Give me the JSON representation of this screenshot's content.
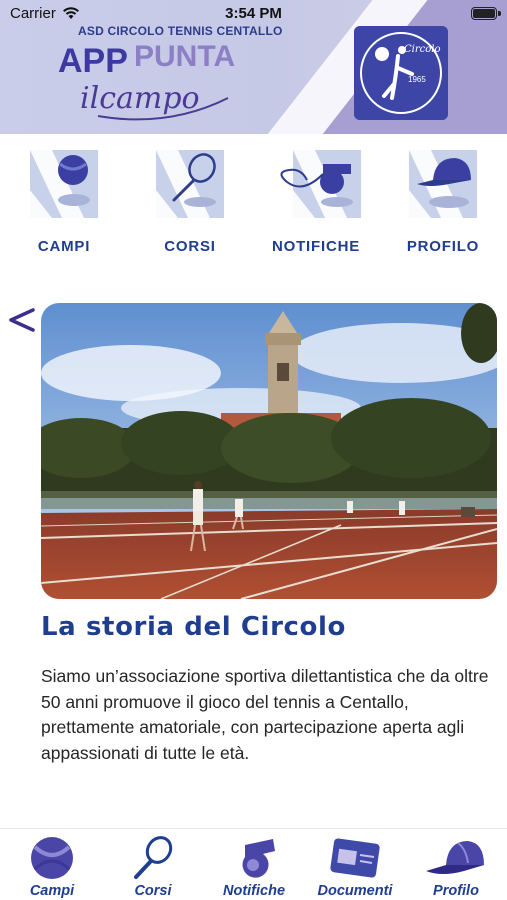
{
  "status_bar": {
    "carrier": "Carrier",
    "time": "3:54 PM"
  },
  "header": {
    "club_name": "ASD CIRCOLO TENNIS CENTALLO",
    "logo_app": "APP",
    "logo_punta": "PUNTA",
    "logo_tagline": "ilcampo",
    "club_logo_text": "Circolo",
    "club_logo_year": "1965"
  },
  "top_menu": {
    "items": [
      {
        "label": "CAMPI",
        "icon": "tennis-ball-icon"
      },
      {
        "label": "CORSI",
        "icon": "racket-icon"
      },
      {
        "label": "NOTIFICHE",
        "icon": "whistle-icon"
      },
      {
        "label": "PROFILO",
        "icon": "cap-icon"
      }
    ]
  },
  "slider": {
    "back_icon": "chevron-left-icon",
    "image": "vintage photo of tennis courts with bell tower"
  },
  "content": {
    "title": "La storia del Circolo",
    "body": "Siamo un’associazione sportiva dilettantistica che da oltre 50 anni promuove il gioco del tennis a Centallo, prettamente amatoriale, con partecipazione aperta agli appassionati di tutte le età."
  },
  "tab_bar": {
    "tabs": [
      {
        "label": "Campi",
        "icon": "tennis-ball-icon"
      },
      {
        "label": "Corsi",
        "icon": "racket-icon"
      },
      {
        "label": "Notifiche",
        "icon": "whistle-icon"
      },
      {
        "label": "Documenti",
        "icon": "card-icon"
      },
      {
        "label": "Profilo",
        "icon": "cap-icon"
      }
    ]
  },
  "colors": {
    "brand_blue": "#1f3e8f",
    "header_lilac": "#c9cde9",
    "logo_purple": "#5a3e9c",
    "club_logo_bg": "#3d46a6"
  }
}
